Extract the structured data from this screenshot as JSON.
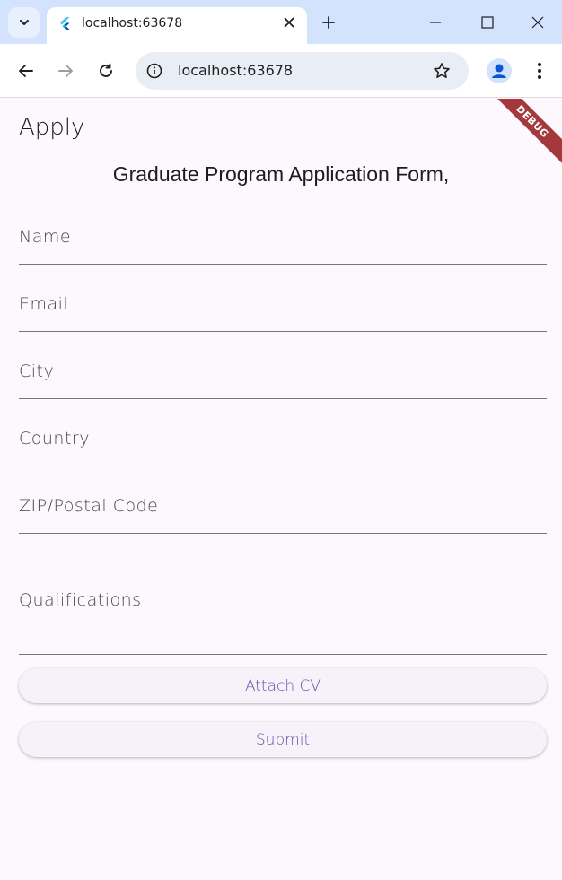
{
  "browser": {
    "tab_title": "localhost:63678",
    "url": "localhost:63678",
    "colors": {
      "tabstrip": "#d3e3fd",
      "toolbar": "#ffffff"
    },
    "icons": [
      "tab-search-icon",
      "flutter-favicon-icon",
      "close-icon",
      "plus-icon",
      "minimize-icon",
      "maximize-icon",
      "window-close-icon",
      "back-arrow-icon",
      "forward-arrow-icon",
      "reload-icon",
      "info-icon",
      "star-icon",
      "profile-icon",
      "kebab-menu-icon"
    ]
  },
  "app": {
    "title": "Apply",
    "heading": "Graduate Program Application Form,",
    "debug_banner": "DEBUG",
    "fields": {
      "name": "Name",
      "email": "Email",
      "city": "City",
      "country": "Country",
      "zip": "ZIP/Postal Code",
      "qualifications": "Qualifications"
    },
    "buttons": {
      "attach_cv": "Attach CV",
      "submit": "Submit"
    },
    "colors": {
      "background": "#fdf7fe",
      "accent": "#6750a4",
      "underline": "#79747e",
      "debug": "#a4383a"
    }
  }
}
